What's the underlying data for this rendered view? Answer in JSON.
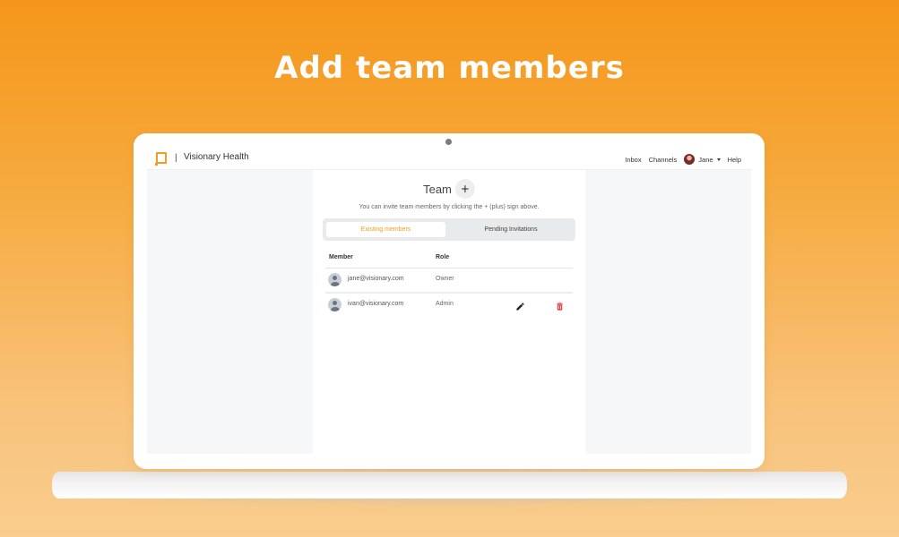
{
  "headline": "Add team members",
  "app": {
    "brand_name": "Visionary Health",
    "separator": "|",
    "nav": {
      "inbox": "Inbox",
      "channels": "Channels",
      "user_name": "Jane",
      "help": "Help"
    }
  },
  "team": {
    "title": "Team",
    "add_label": "+",
    "hint": "You can invite team members by clicking the + (plus) sign above.",
    "tabs": [
      {
        "label": "Existing members",
        "active": true
      },
      {
        "label": "Pending Invitations",
        "active": false
      }
    ],
    "columns": [
      "Member",
      "Role"
    ],
    "members": [
      {
        "email": "jane@visionary.com",
        "role": "Owner"
      },
      {
        "email": "ivan@visionary.com",
        "role": "Admin"
      }
    ]
  },
  "colors": {
    "accent": "#f39c1f",
    "delete": "#e53935",
    "background_top": "#f5961a"
  },
  "icons": [
    "logo-icon",
    "user-avatar",
    "chevron-down-icon",
    "plus-icon",
    "person-icon",
    "edit-pencil-icon",
    "trash-icon"
  ]
}
